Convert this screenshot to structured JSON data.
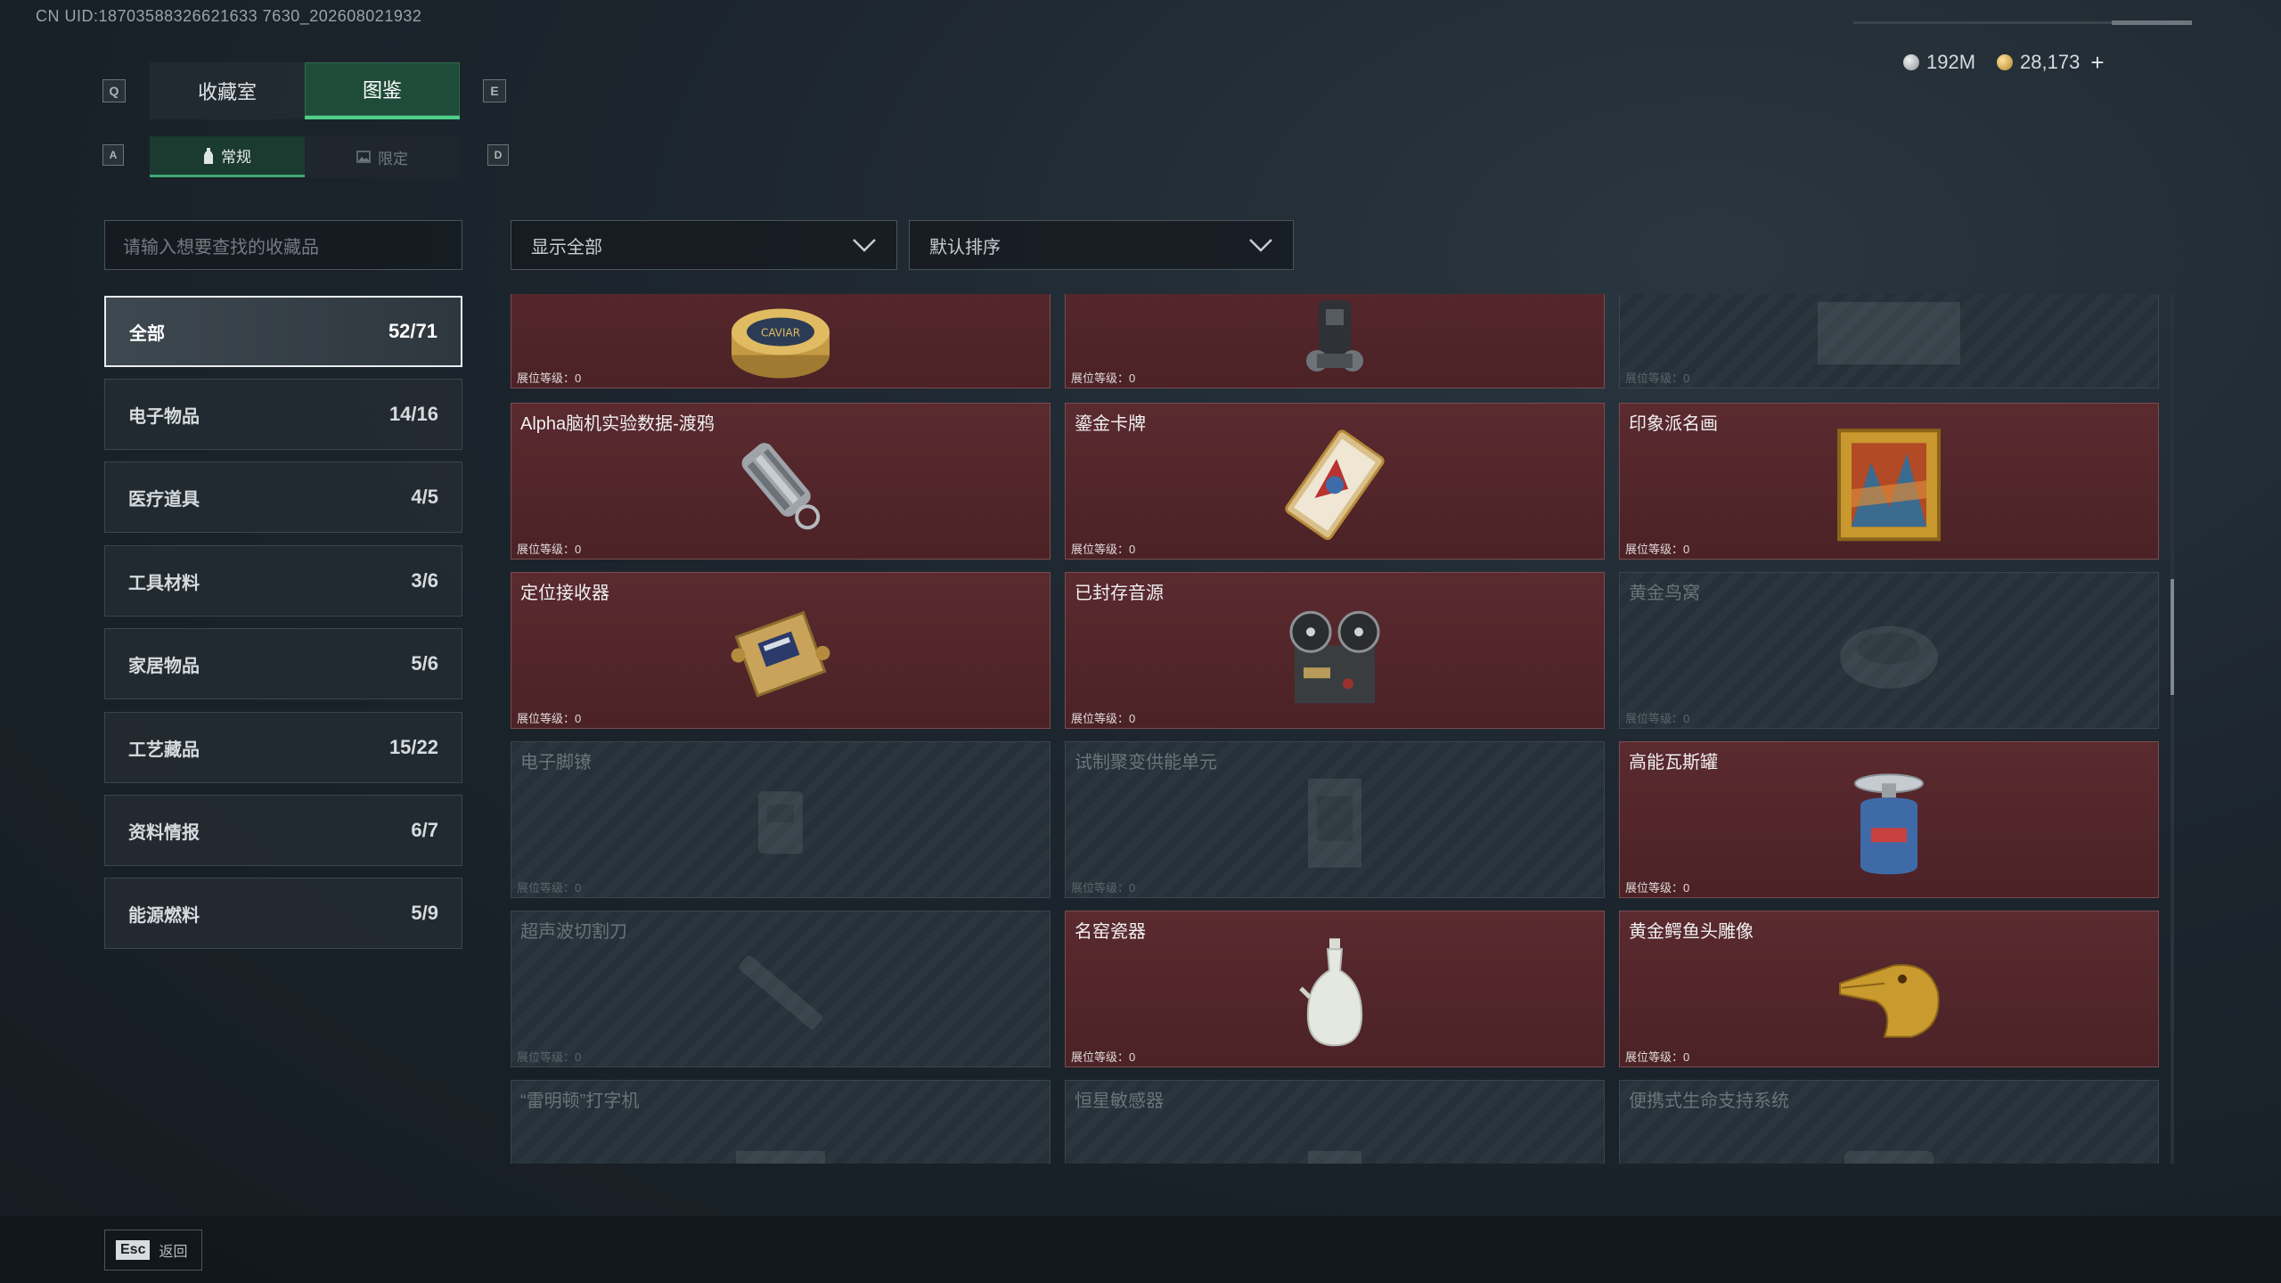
{
  "uid": "CN UID:18703588326621633 7630_202608021932",
  "tabs": {
    "key_left": "Q",
    "key_right": "E",
    "items": [
      "收藏室",
      "图鉴"
    ]
  },
  "subtabs": {
    "key_left": "A",
    "key_right": "D",
    "items": [
      "常规",
      "限定"
    ]
  },
  "currency": {
    "silver": "192M",
    "gold": "28,173",
    "plus": "+"
  },
  "search": {
    "placeholder": "请输入想要查找的收藏品"
  },
  "filters": {
    "show": "显示全部",
    "sort": "默认排序"
  },
  "categories": [
    {
      "label": "全部",
      "count": "52/71"
    },
    {
      "label": "电子物品",
      "count": "14/16"
    },
    {
      "label": "医疗道具",
      "count": "4/5"
    },
    {
      "label": "工具材料",
      "count": "3/6"
    },
    {
      "label": "家居物品",
      "count": "5/6"
    },
    {
      "label": "工艺藏品",
      "count": "15/22"
    },
    {
      "label": "资料情报",
      "count": "6/7"
    },
    {
      "label": "能源燃料",
      "count": "5/9"
    }
  ],
  "cards": [
    {
      "name": "",
      "level": "展位等级：0",
      "icon": "caviar-tin-icon",
      "owned": true
    },
    {
      "name": "",
      "level": "展位等级：0",
      "icon": "diving-tank-icon",
      "owned": true
    },
    {
      "name": "",
      "level": "展位等级：0",
      "icon": "unknown-item-icon",
      "owned": false
    },
    {
      "name": "Alpha脑机实验数据-渡鸦",
      "level": "展位等级：0",
      "icon": "data-drive-icon",
      "owned": true
    },
    {
      "name": "鎏金卡牌",
      "level": "展位等级：0",
      "icon": "gilded-card-icon",
      "owned": true
    },
    {
      "name": "印象派名画",
      "level": "展位等级：0",
      "icon": "painting-icon",
      "owned": true
    },
    {
      "name": "定位接收器",
      "level": "展位等级：0",
      "icon": "receiver-icon",
      "owned": true
    },
    {
      "name": "已封存音源",
      "level": "展位等级：0",
      "icon": "tape-recorder-icon",
      "owned": true
    },
    {
      "name": "黄金鸟窝",
      "level": "展位等级：0",
      "icon": "bird-nest-icon",
      "owned": false
    },
    {
      "name": "电子脚镣",
      "level": "展位等级：0",
      "icon": "ankle-monitor-icon",
      "owned": false
    },
    {
      "name": "试制聚变供能单元",
      "level": "展位等级：0",
      "icon": "fusion-cell-icon",
      "owned": false
    },
    {
      "name": "高能瓦斯罐",
      "level": "展位等级：0",
      "icon": "gas-canister-icon",
      "owned": true
    },
    {
      "name": "超声波切割刀",
      "level": "展位等级：0",
      "icon": "cutter-icon",
      "owned": false
    },
    {
      "name": "名窑瓷器",
      "level": "展位等级：0",
      "icon": "porcelain-vase-icon",
      "owned": true
    },
    {
      "name": "黄金鳄鱼头雕像",
      "level": "展位等级：0",
      "icon": "crocodile-statue-icon",
      "owned": true
    },
    {
      "name": "“雷明顿”打字机",
      "level": "",
      "icon": "typewriter-icon",
      "owned": false
    },
    {
      "name": "恒星敏感器",
      "level": "",
      "icon": "star-sensor-icon",
      "owned": false
    },
    {
      "name": "便携式生命支持系统",
      "level": "",
      "icon": "life-support-icon",
      "owned": false
    }
  ],
  "footer": {
    "key": "Esc",
    "label": "返回"
  }
}
